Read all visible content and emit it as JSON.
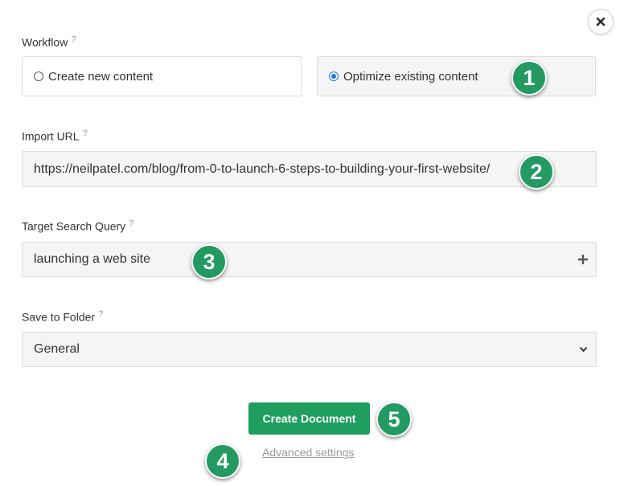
{
  "workflow": {
    "label": "Workflow",
    "help": "?",
    "options": [
      {
        "label": "Create new content",
        "selected": false
      },
      {
        "label": "Optimize existing content",
        "selected": true
      }
    ]
  },
  "import_url": {
    "label": "Import URL",
    "help": "?",
    "value": "https://neilpatel.com/blog/from-0-to-launch-6-steps-to-building-your-first-website/"
  },
  "target_query": {
    "label": "Target Search Query",
    "help": "?",
    "value": "launching a web site",
    "add_icon": "plus-icon"
  },
  "save_folder": {
    "label": "Save to Folder",
    "help": "?",
    "selected": "General",
    "dropdown_icon": "chevron-down-icon"
  },
  "actions": {
    "create_label": "Create Document",
    "advanced_label": "Advanced settings"
  },
  "close_icon": "close-icon",
  "badges": [
    "1",
    "2",
    "3",
    "4",
    "5"
  ],
  "colors": {
    "primary": "#1f9e5e",
    "badge": "#229a62",
    "radio_selected": "#1a73e8"
  }
}
